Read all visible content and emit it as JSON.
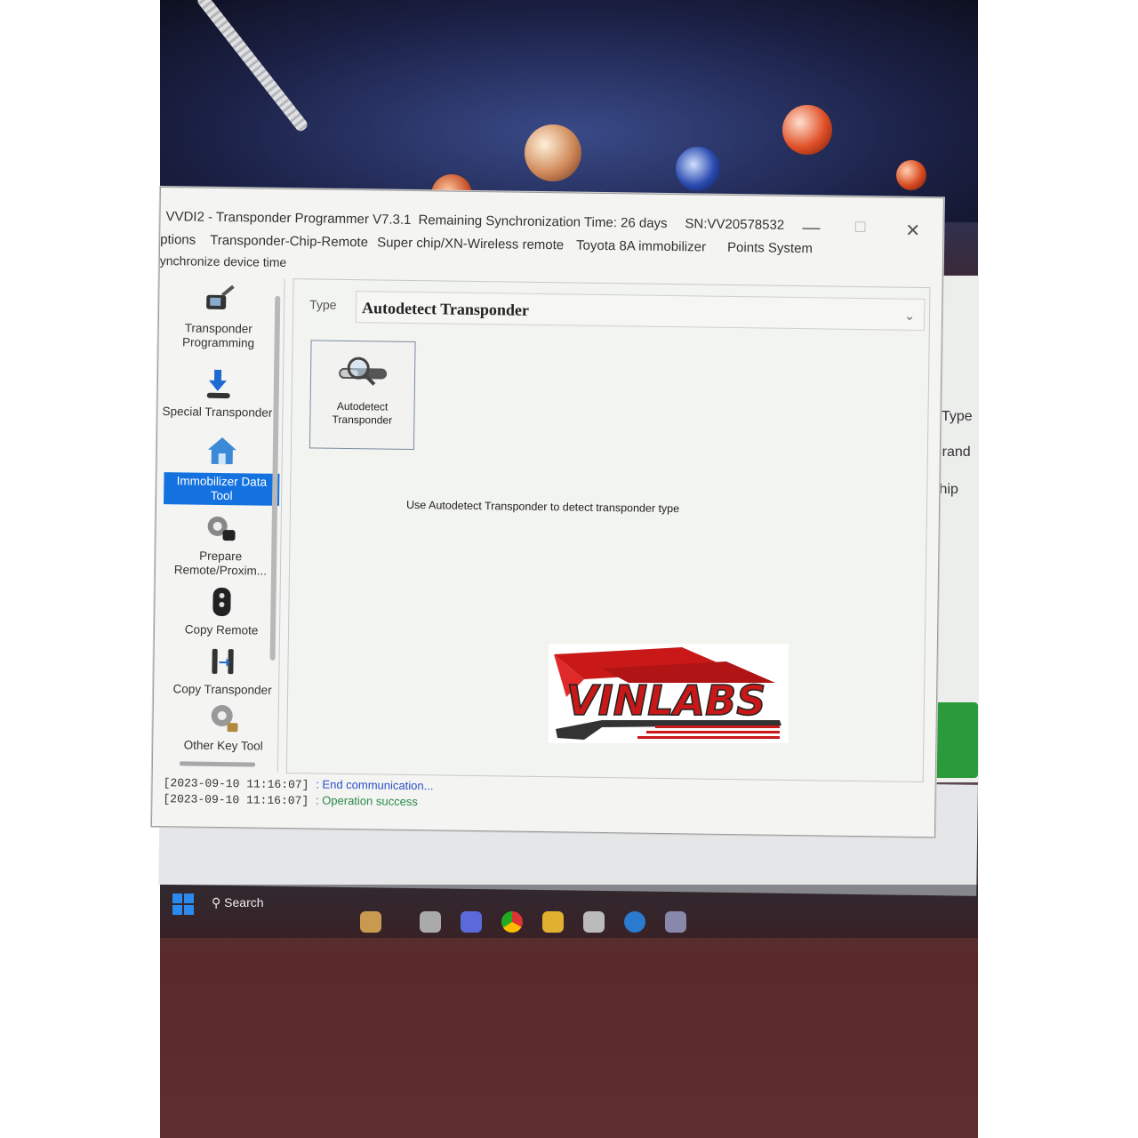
{
  "window": {
    "title": "VVDI2 - Transponder Programmer V7.3.1",
    "sync_time": "Remaining Synchronization Time: 26 days",
    "serial": "SN:VV20578532",
    "min_label": "—",
    "max_label": "☐",
    "close_label": "✕"
  },
  "menu": {
    "items": [
      "ptions",
      "Transponder-Chip-Remote",
      "Super chip/XN-Wireless remote",
      "Toyota 8A immobilizer",
      "Points System"
    ],
    "sub": "ynchronize device time"
  },
  "sidebar": {
    "items": [
      {
        "label": "Transponder Programming",
        "icon": "transponder-programmer-icon"
      },
      {
        "label": "Special Transponder",
        "icon": "download-arrow-icon"
      },
      {
        "label": "Immobilizer Data Tool",
        "icon": "immobilizer-house-icon",
        "selected": true
      },
      {
        "label": "Prepare Remote/Proxim...",
        "icon": "gear-remote-icon"
      },
      {
        "label": "Copy Remote",
        "icon": "car-remote-icon"
      },
      {
        "label": "Copy Transponder",
        "icon": "copy-transponder-icon"
      },
      {
        "label": "Other Key Tool",
        "icon": "key-gear-icon"
      }
    ]
  },
  "content": {
    "type_label": "Type",
    "type_value": "Autodetect Transponder",
    "tile_label": "Autodetect Transponder",
    "hint": "Use Autodetect Transponder to detect transponder type"
  },
  "log": [
    {
      "time": "[2023-09-10 11:16:07]",
      "msg": ": End communication..."
    },
    {
      "time": "[2023-09-10 11:16:07]",
      "msg": ": Operation success"
    }
  ],
  "background_window": {
    "labels": [
      "Type",
      "Brand",
      "Chip"
    ]
  },
  "taskbar": {
    "search": "Search"
  },
  "watermark": "VINLABS"
}
